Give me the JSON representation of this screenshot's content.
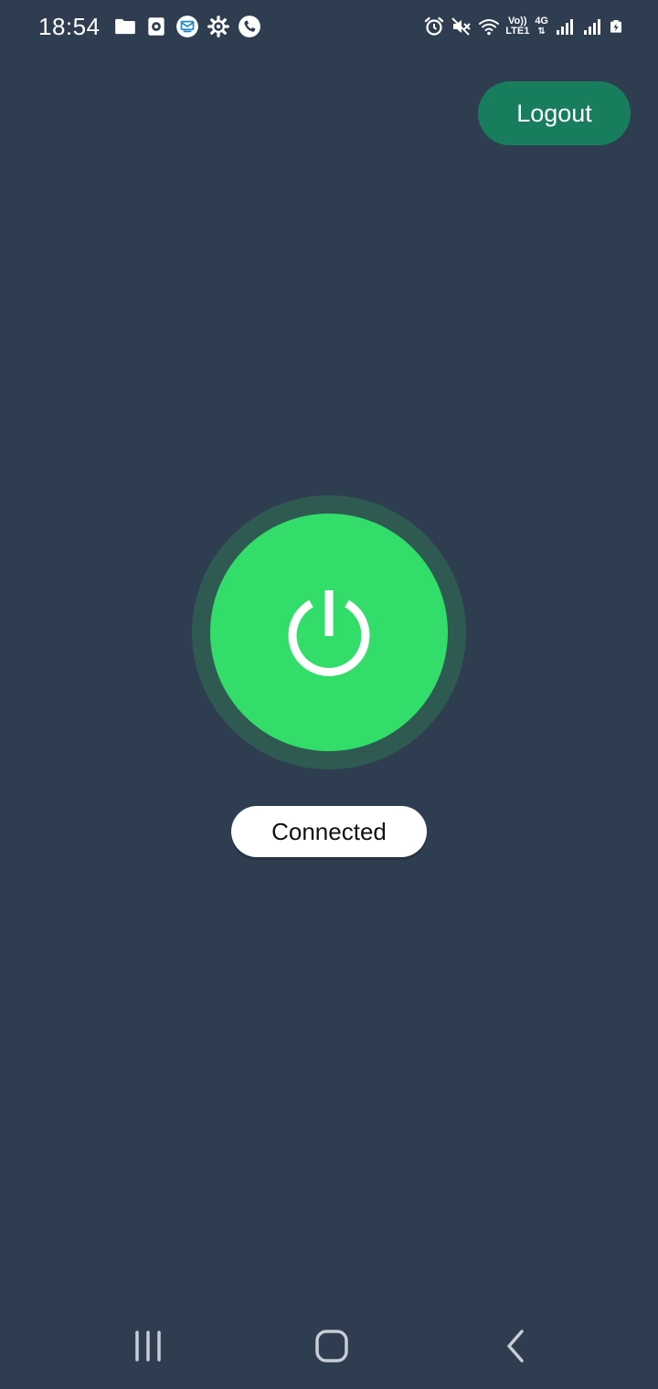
{
  "status_bar": {
    "time": "18:54",
    "left_icons": [
      "folder-icon",
      "camera-icon",
      "message-icon",
      "settings-icon",
      "phone-icon"
    ],
    "right_icons": [
      "alarm-icon",
      "mute-icon",
      "wifi-icon",
      "volte-icon",
      "network-4g-icon",
      "signal-icon",
      "signal-icon",
      "battery-icon"
    ],
    "volte_top": "Vo))",
    "volte_bottom": "LTE1",
    "network_type": "4G"
  },
  "header": {
    "logout_label": "Logout"
  },
  "vpn": {
    "status_text": "Connected",
    "icon": "power-icon"
  },
  "colors": {
    "background": "#2e3d50",
    "accent_green": "#33dd6a",
    "ring": "#2f5a52",
    "logout_bg": "#177d5c"
  },
  "nav_bar": {
    "items": [
      "recents-icon",
      "home-icon",
      "back-icon"
    ]
  }
}
